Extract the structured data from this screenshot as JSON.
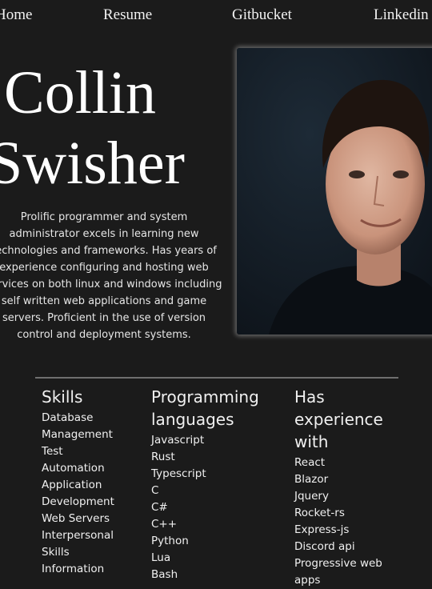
{
  "nav": {
    "items": [
      {
        "label": "Home"
      },
      {
        "label": "Resume"
      },
      {
        "label": "Gitbucket"
      },
      {
        "label": "Linkedin"
      }
    ]
  },
  "hero": {
    "first_name": "Collin",
    "last_name": "Swisher",
    "bio": "Prolific programmer and system administrator excels in learning new technologies and frameworks. Has years of experience configuring and hosting web services on both linux and windows including self written web applications and game servers. Proficient in the use of version control and deployment systems."
  },
  "photo": {
    "alt": "Portrait of Collin Swisher"
  },
  "skills": {
    "title": "Skills",
    "items": [
      "Database",
      "Management",
      "Test",
      "Automation",
      "Application",
      "Development",
      "Web Servers",
      "Interpersonal",
      "Skills",
      "Information"
    ]
  },
  "languages": {
    "title": "Programming languages",
    "items": [
      "Javascript",
      "Rust",
      "Typescript",
      "C",
      "C#",
      "C++",
      "Python",
      "Lua",
      "Bash"
    ]
  },
  "experience": {
    "title": "Has experience with",
    "items": [
      "React",
      "Blazor",
      "Jquery",
      "Rocket-rs",
      "Express-js",
      "Discord api",
      "Progressive web apps"
    ]
  }
}
